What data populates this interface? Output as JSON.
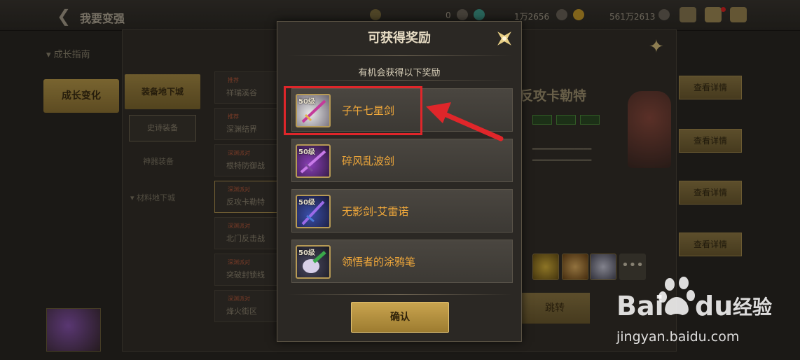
{
  "top_bar": {
    "title": "我要变强",
    "currency_1": "0",
    "currency_2": "1万2656",
    "currency_3": "561万2613"
  },
  "left_nav": {
    "header": "成长指南",
    "active": "成长变化"
  },
  "background": {
    "sub_active": "装备地下城",
    "sub_button": "史诗装备",
    "sub_text_1": "神器装备",
    "sub_text_2": "材料地下城",
    "list": [
      {
        "tag": "推荐",
        "name": "祥瑞溪谷"
      },
      {
        "tag": "推荐",
        "name": "深渊结界"
      },
      {
        "tag": "深渊派对",
        "name": "根特防御战"
      },
      {
        "tag": "深渊派对",
        "name": "反攻卡勒特"
      },
      {
        "tag": "深渊派对",
        "name": "北门反击战"
      },
      {
        "tag": "深渊派对",
        "name": "突破封锁线"
      },
      {
        "tag": "深渊派对",
        "name": "烽火街区"
      }
    ],
    "heading": "反攻卡勒特",
    "detail_button": "查看详情",
    "jump_button": "跳转"
  },
  "modal": {
    "title": "可获得奖励",
    "subtitle": "有机会获得以下奖励",
    "rewards": [
      {
        "level": "50级",
        "name": "子午七星剑",
        "icon": "sword-icon"
      },
      {
        "level": "50级",
        "name": "碎风乱波剑",
        "icon": "sword-icon"
      },
      {
        "level": "50级",
        "name": "无影剑-艾雷诺",
        "icon": "sword-icon"
      },
      {
        "level": "50级",
        "name": "领悟者的涂鸦笔",
        "icon": "brush-icon"
      }
    ],
    "confirm_label": "确认"
  },
  "watermark": {
    "brand": "Bai du 经验",
    "url": "jingyan.baidu.com"
  },
  "colors": {
    "reward_name": "#f2a93a",
    "highlight": "#e0262a",
    "button_gold": "#c9a44f"
  }
}
